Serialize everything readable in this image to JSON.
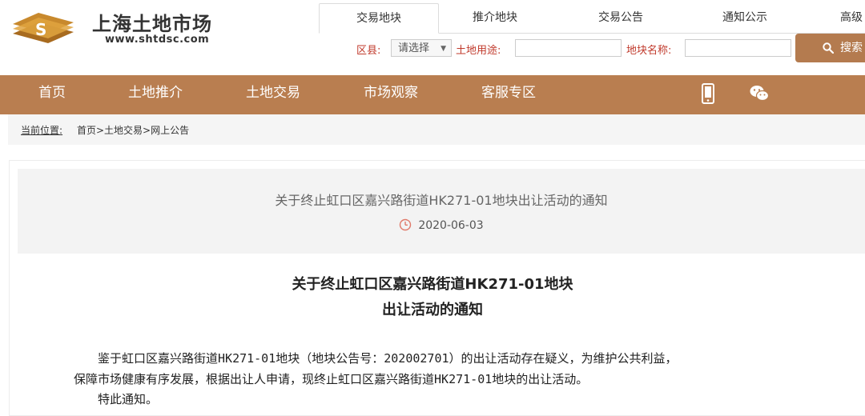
{
  "brand": {
    "name": "上海土地市场",
    "url": "www.shtdsc.com",
    "logo_color": "#c8892d"
  },
  "search": {
    "tabs": [
      "交易地块",
      "推介地块",
      "交易公告",
      "通知公示",
      "高级"
    ],
    "active_tab": "交易地块",
    "district_label": "区县:",
    "district_select": "请选择",
    "usage_label": "土地用途:",
    "usage_value": "",
    "name_label": "地块名称:",
    "name_value": "",
    "button_label": "搜索"
  },
  "nav": {
    "items": [
      "首页",
      "土地推介",
      "土地交易",
      "市场观察",
      "客服专区"
    ],
    "mobile_icon": "mobile-phone-icon",
    "wechat_icon": "wechat-icon",
    "bg_color": "#b97e50"
  },
  "breadcrumb": {
    "label": "当前位置:",
    "path": "首页>土地交易>网上公告"
  },
  "article": {
    "title": "关于终止虹口区嘉兴路街道HK271-01地块出让活动的通知",
    "date": "2020-06-03",
    "doc_title_line1": "关于终止虹口区嘉兴路街道HK271-01地块",
    "doc_title_line2": "出让活动的通知",
    "body_line1": "　　鉴于虹口区嘉兴路街道HK271-01地块（地块公告号：202002701）的出让活动存在疑义，为维护公共利益，",
    "body_line2": "保障市场健康有序发展，根据出让人申请，现终止虹口区嘉兴路街道HK271-01地块的出让活动。",
    "body_line3": "　　特此通知。"
  }
}
